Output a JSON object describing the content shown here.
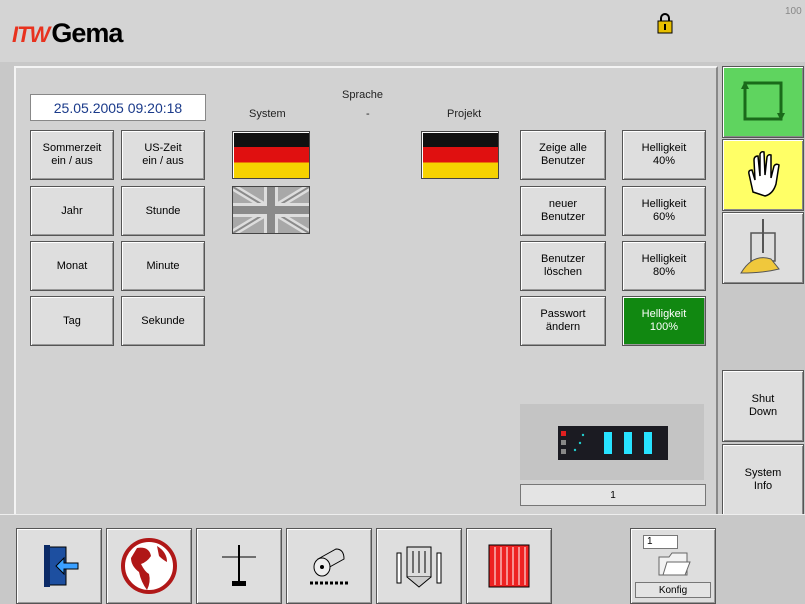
{
  "header": {
    "brand_prefix": "ITW",
    "brand_name": "Gema",
    "corner_text": "100"
  },
  "datetime": "25.05.2005 09:20:18",
  "language": {
    "title": "Sprache",
    "system_label": "System",
    "separator": "-",
    "project_label": "Projekt"
  },
  "time_buttons": [
    "Sommerzeit\nein / aus",
    "US-Zeit\nein / aus",
    "Jahr",
    "Stunde",
    "Monat",
    "Minute",
    "Tag",
    "Sekunde"
  ],
  "user_buttons": [
    "Zeige alle\nBenutzer",
    "neuer\nBenutzer",
    "Benutzer\nlöschen",
    "Passwort\nändern"
  ],
  "brightness_buttons": [
    {
      "label": "Helligkeit\n40%",
      "active": false
    },
    {
      "label": "Helligkeit\n60%",
      "active": false
    },
    {
      "label": "Helligkeit\n80%",
      "active": false
    },
    {
      "label": "Helligkeit\n100%",
      "active": true
    }
  ],
  "device_number": "1",
  "sidebar": {
    "shutdown_label": "Shut\nDown",
    "sysinfo_label": "System\nInfo"
  },
  "bottom": {
    "konfig_label": "Konfig",
    "konfig_number": "1"
  },
  "colors": {
    "active_green": "#118811",
    "cycle_green": "#5fd45f",
    "hand_yellow": "#ffff66"
  },
  "icons": [
    "exit-door-icon",
    "globe-icon",
    "gun-icon",
    "powder-roller-icon",
    "booth-icon",
    "pump-grid-icon",
    "folder-icon"
  ]
}
